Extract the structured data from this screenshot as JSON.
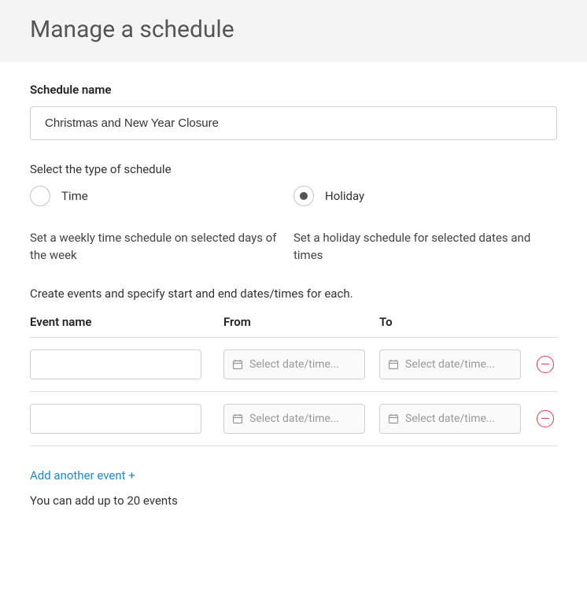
{
  "header": {
    "title": "Manage a schedule"
  },
  "scheduleName": {
    "label": "Schedule name",
    "value": "Christmas and New Year Closure"
  },
  "typeSection": {
    "label": "Select the type of schedule",
    "options": {
      "time": {
        "label": "Time",
        "description": "Set a weekly time schedule on selected days of the week",
        "selected": false
      },
      "holiday": {
        "label": "Holiday",
        "description": "Set a holiday schedule for selected dates and times",
        "selected": true
      }
    }
  },
  "eventsSection": {
    "intro": "Create events and specify start and end dates/times for each.",
    "columns": {
      "name": "Event name",
      "from": "From",
      "to": "To"
    },
    "datePlaceholder": "Select date/time...",
    "rows": [
      {
        "name": "",
        "from": "",
        "to": ""
      },
      {
        "name": "",
        "from": "",
        "to": ""
      }
    ],
    "addLink": "Add another event +",
    "limit": "You can add up to 20 events"
  }
}
